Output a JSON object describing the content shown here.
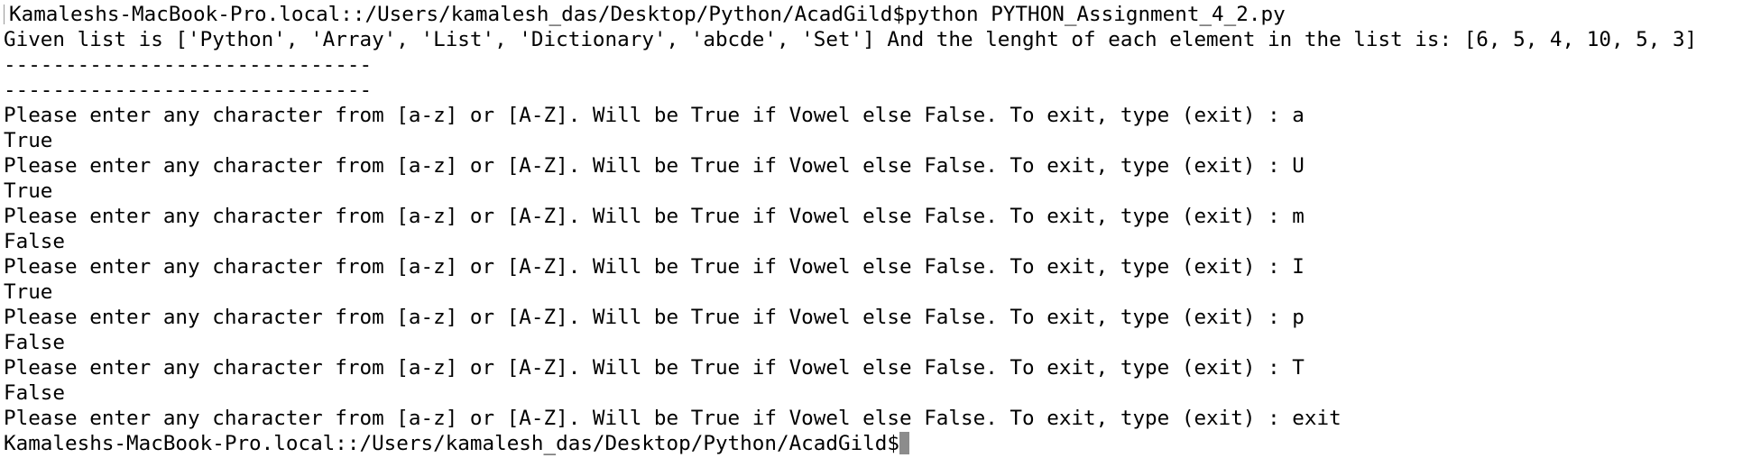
{
  "terminal": {
    "lines": [
      "Kamaleshs-MacBook-Pro.local::/Users/kamalesh_das/Desktop/Python/AcadGild$python PYTHON_Assignment_4_2.py",
      "Given list is ['Python', 'Array', 'List', 'Dictionary', 'abcde', 'Set'] And the lenght of each element in the list is: [6, 5, 4, 10, 5, 3]",
      "------------------------------",
      "------------------------------",
      "Please enter any character from [a-z] or [A-Z]. Will be True if Vowel else False. To exit, type (exit) : a",
      "True",
      "Please enter any character from [a-z] or [A-Z]. Will be True if Vowel else False. To exit, type (exit) : U",
      "True",
      "Please enter any character from [a-z] or [A-Z]. Will be True if Vowel else False. To exit, type (exit) : m",
      "False",
      "Please enter any character from [a-z] or [A-Z]. Will be True if Vowel else False. To exit, type (exit) : I",
      "True",
      "Please enter any character from [a-z] or [A-Z]. Will be True if Vowel else False. To exit, type (exit) : p",
      "False",
      "Please enter any character from [a-z] or [A-Z]. Will be True if Vowel else False. To exit, type (exit) : T",
      "False",
      "Please enter any character from [a-z] or [A-Z]. Will be True if Vowel else False. To exit, type (exit) : exit"
    ],
    "prompt": "Kamaleshs-MacBook-Pro.local::/Users/kamalesh_das/Desktop/Python/AcadGild$"
  },
  "colors": {
    "background": "#ffffff",
    "text": "#000000",
    "cursor": "#8c8c8c"
  }
}
